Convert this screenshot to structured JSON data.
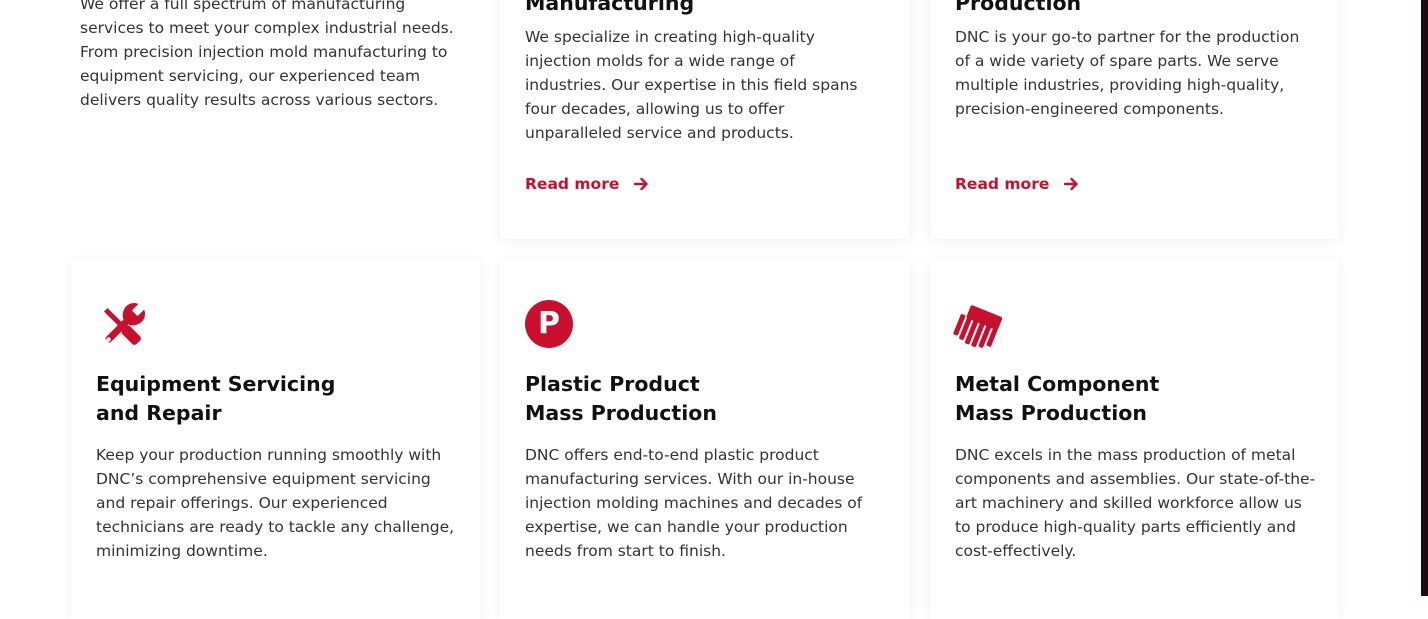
{
  "intro": {
    "text": "We offer a full spectrum of manufacturing services to meet your complex industrial needs. From precision injection mold manufacturing to equipment servicing, our experienced team delivers quality results across various sectors."
  },
  "top_cards": [
    {
      "title_line1": "Manufacturing",
      "description": "We specialize in creating high-quality injection molds for a wide range of industries. Our expertise in this field spans four decades, allowing us to offer unparalleled service and products.",
      "link_label": "Read more",
      "link_icon": "arrow-right-icon"
    },
    {
      "title_line1": "Production",
      "description": "DNC is your go-to partner for the production of a wide variety of spare parts. We serve multiple industries, providing high-quality, precision-engineered components.",
      "link_label": "Read more",
      "link_icon": "arrow-right-icon"
    }
  ],
  "bottom_cards": [
    {
      "icon": "wrench-screwdriver-icon",
      "title_line1": "Equipment Servicing",
      "title_line2": "and Repair",
      "description": "Keep your production running smoothly with DNC’s comprehensive equipment servicing and repair offerings. Our experienced technicians are ready to tackle any challenge, minimizing downtime."
    },
    {
      "icon": "plastic-p-icon",
      "icon_letter": "P",
      "title_line1": "Plastic Product",
      "title_line2": "Mass Production",
      "description": "DNC offers end-to-end plastic product manufacturing services. With our in-house injection molding machines and decades of expertise, we can handle your production needs from start to finish."
    },
    {
      "icon": "metal-comb-icon",
      "title_line1": "Metal Component",
      "title_line2": "Mass Production",
      "description": "DNC excels in the mass production of metal components and assemblies. Our state-of-the-art machinery and skilled workforce allow us to produce high-quality parts efficiently and cost-effectively."
    }
  ],
  "colors": {
    "accent": "#c8102e",
    "text": "#333333",
    "heading": "#111111",
    "strip": "#1d0b12"
  }
}
